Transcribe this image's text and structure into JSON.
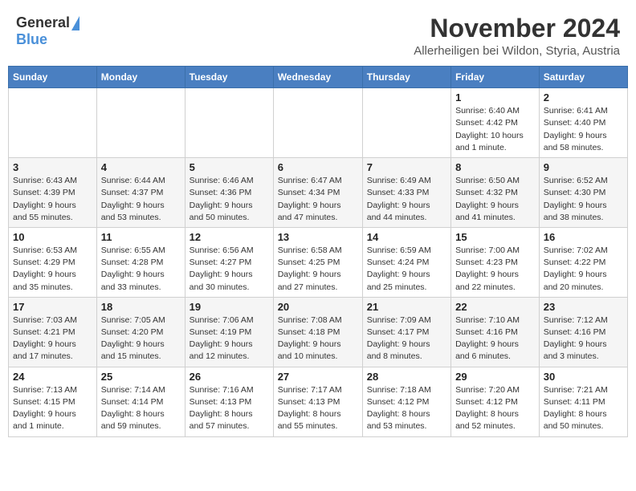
{
  "logo": {
    "general": "General",
    "blue": "Blue"
  },
  "title": "November 2024",
  "location": "Allerheiligen bei Wildon, Styria, Austria",
  "headers": [
    "Sunday",
    "Monday",
    "Tuesday",
    "Wednesday",
    "Thursday",
    "Friday",
    "Saturday"
  ],
  "weeks": [
    {
      "days": [
        {
          "num": "",
          "info": ""
        },
        {
          "num": "",
          "info": ""
        },
        {
          "num": "",
          "info": ""
        },
        {
          "num": "",
          "info": ""
        },
        {
          "num": "",
          "info": ""
        },
        {
          "num": "1",
          "info": "Sunrise: 6:40 AM\nSunset: 4:42 PM\nDaylight: 10 hours\nand 1 minute."
        },
        {
          "num": "2",
          "info": "Sunrise: 6:41 AM\nSunset: 4:40 PM\nDaylight: 9 hours\nand 58 minutes."
        }
      ]
    },
    {
      "days": [
        {
          "num": "3",
          "info": "Sunrise: 6:43 AM\nSunset: 4:39 PM\nDaylight: 9 hours\nand 55 minutes."
        },
        {
          "num": "4",
          "info": "Sunrise: 6:44 AM\nSunset: 4:37 PM\nDaylight: 9 hours\nand 53 minutes."
        },
        {
          "num": "5",
          "info": "Sunrise: 6:46 AM\nSunset: 4:36 PM\nDaylight: 9 hours\nand 50 minutes."
        },
        {
          "num": "6",
          "info": "Sunrise: 6:47 AM\nSunset: 4:34 PM\nDaylight: 9 hours\nand 47 minutes."
        },
        {
          "num": "7",
          "info": "Sunrise: 6:49 AM\nSunset: 4:33 PM\nDaylight: 9 hours\nand 44 minutes."
        },
        {
          "num": "8",
          "info": "Sunrise: 6:50 AM\nSunset: 4:32 PM\nDaylight: 9 hours\nand 41 minutes."
        },
        {
          "num": "9",
          "info": "Sunrise: 6:52 AM\nSunset: 4:30 PM\nDaylight: 9 hours\nand 38 minutes."
        }
      ]
    },
    {
      "days": [
        {
          "num": "10",
          "info": "Sunrise: 6:53 AM\nSunset: 4:29 PM\nDaylight: 9 hours\nand 35 minutes."
        },
        {
          "num": "11",
          "info": "Sunrise: 6:55 AM\nSunset: 4:28 PM\nDaylight: 9 hours\nand 33 minutes."
        },
        {
          "num": "12",
          "info": "Sunrise: 6:56 AM\nSunset: 4:27 PM\nDaylight: 9 hours\nand 30 minutes."
        },
        {
          "num": "13",
          "info": "Sunrise: 6:58 AM\nSunset: 4:25 PM\nDaylight: 9 hours\nand 27 minutes."
        },
        {
          "num": "14",
          "info": "Sunrise: 6:59 AM\nSunset: 4:24 PM\nDaylight: 9 hours\nand 25 minutes."
        },
        {
          "num": "15",
          "info": "Sunrise: 7:00 AM\nSunset: 4:23 PM\nDaylight: 9 hours\nand 22 minutes."
        },
        {
          "num": "16",
          "info": "Sunrise: 7:02 AM\nSunset: 4:22 PM\nDaylight: 9 hours\nand 20 minutes."
        }
      ]
    },
    {
      "days": [
        {
          "num": "17",
          "info": "Sunrise: 7:03 AM\nSunset: 4:21 PM\nDaylight: 9 hours\nand 17 minutes."
        },
        {
          "num": "18",
          "info": "Sunrise: 7:05 AM\nSunset: 4:20 PM\nDaylight: 9 hours\nand 15 minutes."
        },
        {
          "num": "19",
          "info": "Sunrise: 7:06 AM\nSunset: 4:19 PM\nDaylight: 9 hours\nand 12 minutes."
        },
        {
          "num": "20",
          "info": "Sunrise: 7:08 AM\nSunset: 4:18 PM\nDaylight: 9 hours\nand 10 minutes."
        },
        {
          "num": "21",
          "info": "Sunrise: 7:09 AM\nSunset: 4:17 PM\nDaylight: 9 hours\nand 8 minutes."
        },
        {
          "num": "22",
          "info": "Sunrise: 7:10 AM\nSunset: 4:16 PM\nDaylight: 9 hours\nand 6 minutes."
        },
        {
          "num": "23",
          "info": "Sunrise: 7:12 AM\nSunset: 4:16 PM\nDaylight: 9 hours\nand 3 minutes."
        }
      ]
    },
    {
      "days": [
        {
          "num": "24",
          "info": "Sunrise: 7:13 AM\nSunset: 4:15 PM\nDaylight: 9 hours\nand 1 minute."
        },
        {
          "num": "25",
          "info": "Sunrise: 7:14 AM\nSunset: 4:14 PM\nDaylight: 8 hours\nand 59 minutes."
        },
        {
          "num": "26",
          "info": "Sunrise: 7:16 AM\nSunset: 4:13 PM\nDaylight: 8 hours\nand 57 minutes."
        },
        {
          "num": "27",
          "info": "Sunrise: 7:17 AM\nSunset: 4:13 PM\nDaylight: 8 hours\nand 55 minutes."
        },
        {
          "num": "28",
          "info": "Sunrise: 7:18 AM\nSunset: 4:12 PM\nDaylight: 8 hours\nand 53 minutes."
        },
        {
          "num": "29",
          "info": "Sunrise: 7:20 AM\nSunset: 4:12 PM\nDaylight: 8 hours\nand 52 minutes."
        },
        {
          "num": "30",
          "info": "Sunrise: 7:21 AM\nSunset: 4:11 PM\nDaylight: 8 hours\nand 50 minutes."
        }
      ]
    }
  ]
}
